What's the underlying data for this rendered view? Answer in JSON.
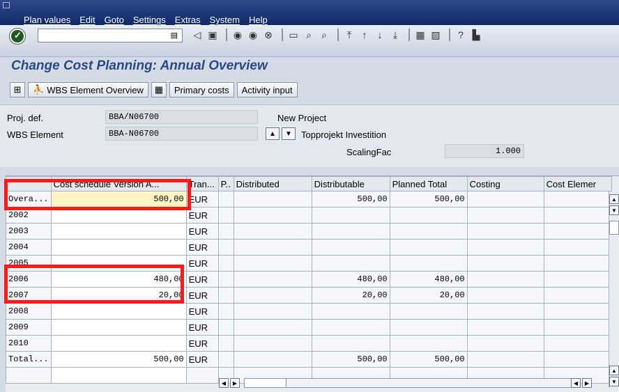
{
  "menu": [
    "Plan values",
    "Edit",
    "Goto",
    "Settings",
    "Extras",
    "System",
    "Help"
  ],
  "title": "Change Cost Planning: Annual Overview",
  "app_toolbar": {
    "wbs_overview": "WBS Element Overview",
    "primary_costs": "Primary costs",
    "activity_input": "Activity input"
  },
  "header": {
    "proj_def_label": "Proj. def.",
    "proj_def_value": "BBA/N06700",
    "proj_def_desc": "New Project",
    "wbs_label": "WBS Element",
    "wbs_value": "BBA-N06700",
    "wbs_desc": "Topprojekt Investition",
    "scaling_label": "ScalingFac",
    "scaling_value": "1.000"
  },
  "columns": [
    "",
    "Cost schedule Version A...",
    "Tran...",
    "P..",
    "Distributed",
    "Distributable",
    "Planned Total",
    "Costing",
    "Cost Elemer"
  ],
  "rows": [
    {
      "year": "Overa...",
      "value": "500,00",
      "cur": "EUR",
      "distributable": "500,00",
      "planned": "500,00"
    },
    {
      "year": "2002",
      "value": "",
      "cur": "EUR",
      "distributable": "",
      "planned": ""
    },
    {
      "year": "2003",
      "value": "",
      "cur": "EUR",
      "distributable": "",
      "planned": ""
    },
    {
      "year": "2004",
      "value": "",
      "cur": "EUR",
      "distributable": "",
      "planned": ""
    },
    {
      "year": "2005",
      "value": "",
      "cur": "EUR",
      "distributable": "",
      "planned": ""
    },
    {
      "year": "2006",
      "value": "480,00",
      "cur": "EUR",
      "distributable": "480,00",
      "planned": "480,00"
    },
    {
      "year": "2007",
      "value": "20,00",
      "cur": "EUR",
      "distributable": "20,00",
      "planned": "20,00"
    },
    {
      "year": "2008",
      "value": "",
      "cur": "EUR",
      "distributable": "",
      "planned": ""
    },
    {
      "year": "2009",
      "value": "",
      "cur": "EUR",
      "distributable": "",
      "planned": ""
    },
    {
      "year": "2010",
      "value": "",
      "cur": "EUR",
      "distributable": "",
      "planned": ""
    },
    {
      "year": "Total...",
      "value": "500,00",
      "cur": "EUR",
      "distributable": "500,00",
      "planned": "500,00"
    },
    {
      "year": "",
      "value": "",
      "cur": "",
      "distributable": "",
      "planned": ""
    }
  ],
  "colors": {
    "highlight": "#ff1a1a",
    "title": "#2a4a86",
    "menubar": "#0f2868"
  }
}
